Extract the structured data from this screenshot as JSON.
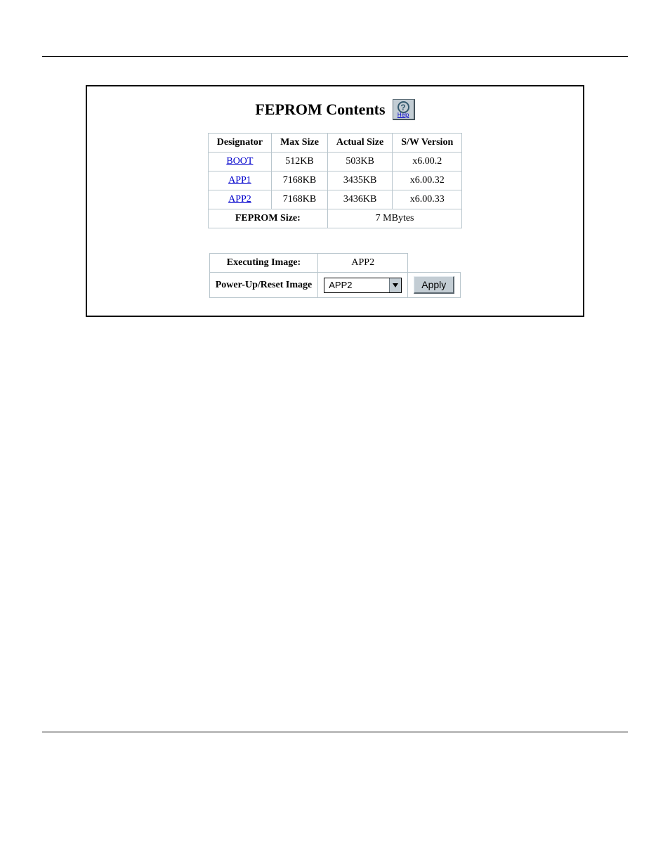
{
  "title": "FEPROM Contents",
  "help": {
    "label": "Help"
  },
  "table": {
    "headers": {
      "designator": "Designator",
      "max_size": "Max Size",
      "actual_size": "Actual Size",
      "sw_version": "S/W Version"
    },
    "rows": [
      {
        "designator": "BOOT",
        "max_size": "512KB",
        "actual_size": "503KB",
        "sw_version": "x6.00.2"
      },
      {
        "designator": "APP1",
        "max_size": "7168KB",
        "actual_size": "3435KB",
        "sw_version": "x6.00.32"
      },
      {
        "designator": "APP2",
        "max_size": "7168KB",
        "actual_size": "3436KB",
        "sw_version": "x6.00.33"
      }
    ],
    "size_label": "FEPROM Size:",
    "size_value": "7 MBytes"
  },
  "form": {
    "executing_label": "Executing Image:",
    "executing_value": "APP2",
    "reset_label": "Power-Up/Reset Image",
    "reset_value": "APP2",
    "apply": "Apply"
  }
}
